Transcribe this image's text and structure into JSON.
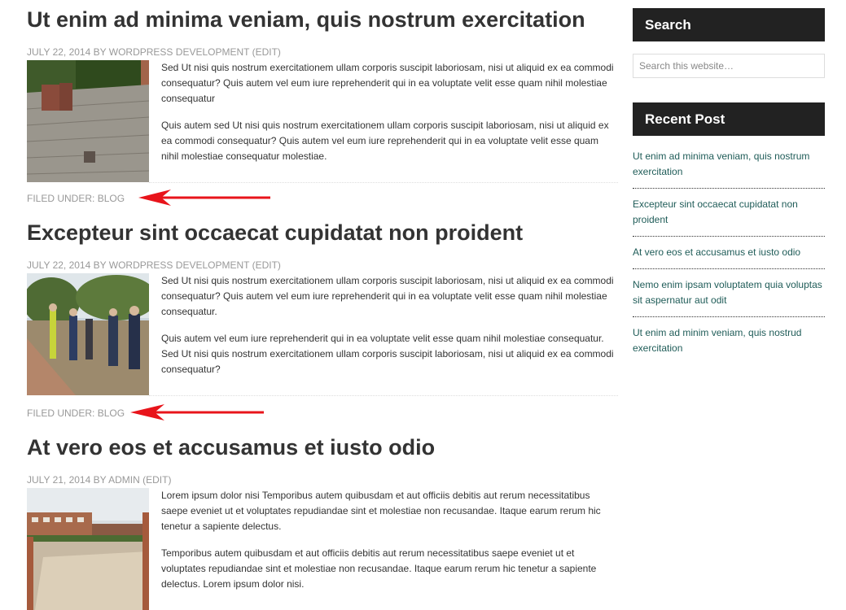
{
  "posts": [
    {
      "title": "Ut enim ad minima veniam, quis nostrum exercitation",
      "date": "JULY 22, 2014",
      "by": "BY",
      "author": "WORDPRESS DEVELOPMENT",
      "edit": "(EDIT)",
      "paragraphs": [
        "Sed Ut nisi quis nostrum exercitationem ullam corporis suscipit laboriosam, nisi ut aliquid ex ea commodi consequatur? Quis autem vel eum iure reprehenderit qui in ea voluptate velit esse quam nihil molestiae consequatur",
        "Quis autem sed Ut nisi quis nostrum exercitationem ullam corporis suscipit laboriosam, nisi ut aliquid ex ea commodi consequatur? Quis autem vel eum iure reprehenderit qui in ea voluptate velit esse quam nihil molestiae consequatur molestiae."
      ],
      "filed_label": "FILED UNDER:",
      "category": "BLOG"
    },
    {
      "title": "Excepteur sint occaecat cupidatat non proident",
      "date": "JULY 22, 2014",
      "by": "BY",
      "author": "WORDPRESS DEVELOPMENT",
      "edit": "(EDIT)",
      "paragraphs": [
        "Sed Ut nisi quis nostrum exercitationem ullam corporis suscipit laboriosam, nisi ut aliquid ex ea commodi consequatur? Quis autem vel eum iure reprehenderit qui in ea voluptate velit esse quam nihil molestiae consequatur.",
        "Quis autem vel eum iure reprehenderit qui in ea voluptate velit esse quam nihil molestiae consequatur. Sed Ut nisi quis nostrum exercitationem ullam corporis suscipit laboriosam, nisi ut aliquid ex ea commodi consequatur?"
      ],
      "filed_label": "FILED UNDER:",
      "category": "BLOG"
    },
    {
      "title": "At vero eos et accusamus et iusto odio",
      "date": "JULY 21, 2014",
      "by": "BY",
      "author": "ADMIN",
      "edit": "(EDIT)",
      "paragraphs": [
        "Lorem ipsum dolor nisi Temporibus autem quibusdam et aut officiis debitis aut rerum necessitatibus saepe eveniet ut et voluptates repudiandae sint et molestiae non recusandae. Itaque earum rerum hic tenetur a sapiente delectus.",
        "Temporibus autem quibusdam et aut officiis debitis aut rerum necessitatibus saepe eveniet ut et voluptates repudiandae sint et molestiae non recusandae. Itaque earum rerum hic tenetur a sapiente delectus. Lorem ipsum dolor nisi."
      ]
    }
  ],
  "sidebar": {
    "search_title": "Search",
    "search_placeholder": "Search this website…",
    "recent_title": "Recent Post",
    "recent_posts": [
      "Ut enim ad minima veniam, quis nostrum exercitation",
      "Excepteur sint occaecat cupidatat non proident",
      "At vero eos et accusamus et iusto odio",
      "Nemo enim ipsam voluptatem quia voluptas sit aspernatur aut odit",
      "Ut enim ad minim veniam, quis nostrud exercitation"
    ]
  },
  "colors": {
    "widget_bg": "#222222",
    "link": "#1f5c58",
    "annotation_arrow": "#e8141b"
  },
  "icons": [
    "red-annotation-arrow"
  ]
}
